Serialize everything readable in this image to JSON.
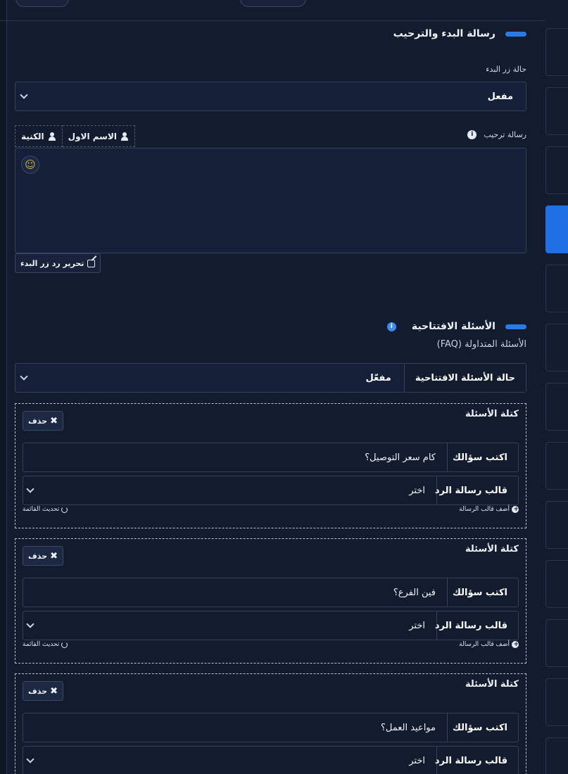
{
  "welcome": {
    "section_title": "رسالة البدء والترحيب",
    "start_status_label": "حالة زر البدء",
    "start_status_value": "مفعل",
    "welcome_message_label": "رسالة ترحيب",
    "info_icon": "ⓘ",
    "variables": [
      "الكنية",
      "الاسم الاول"
    ],
    "emoji_icon": "☺",
    "edit_button": "تحرير رد زر البدء"
  },
  "faq": {
    "section_title": "الأسئلة الافتتاحية",
    "subtitle": "الأسئلة المتداولة (FAQ)",
    "status_label": "حالة الأسئلة الافتتاحية",
    "status_value": "مفعّل",
    "blocks": [
      {
        "title": "كتلة الأسئلة",
        "delete": "حذف",
        "question_label": "اكتب سؤالك",
        "question_value": "كام سعر التوصيل؟",
        "template_label": "قالب رسالة الرد",
        "template_value": "اختر",
        "add_template": "أضف قالب الرسالة",
        "refresh_list": "تحديث القائمة"
      },
      {
        "title": "كتلة الأسئلة",
        "delete": "حذف",
        "question_label": "اكتب سؤالك",
        "question_value": "فين الفرع؟",
        "template_label": "قالب رسالة الرد",
        "template_value": "اختر",
        "add_template": "أضف قالب الرسالة",
        "refresh_list": "تحديث القائمة"
      },
      {
        "title": "كتلة الأسئلة",
        "delete": "حذف",
        "question_label": "اكتب سؤالك",
        "question_value": "مواعيد العمل؟",
        "template_label": "قالب رسالة الرد",
        "template_value": "اختر"
      }
    ]
  },
  "colors": {
    "background": "#131c2e",
    "accent": "#2c7be5",
    "active_tab": "#1f6fe5"
  }
}
